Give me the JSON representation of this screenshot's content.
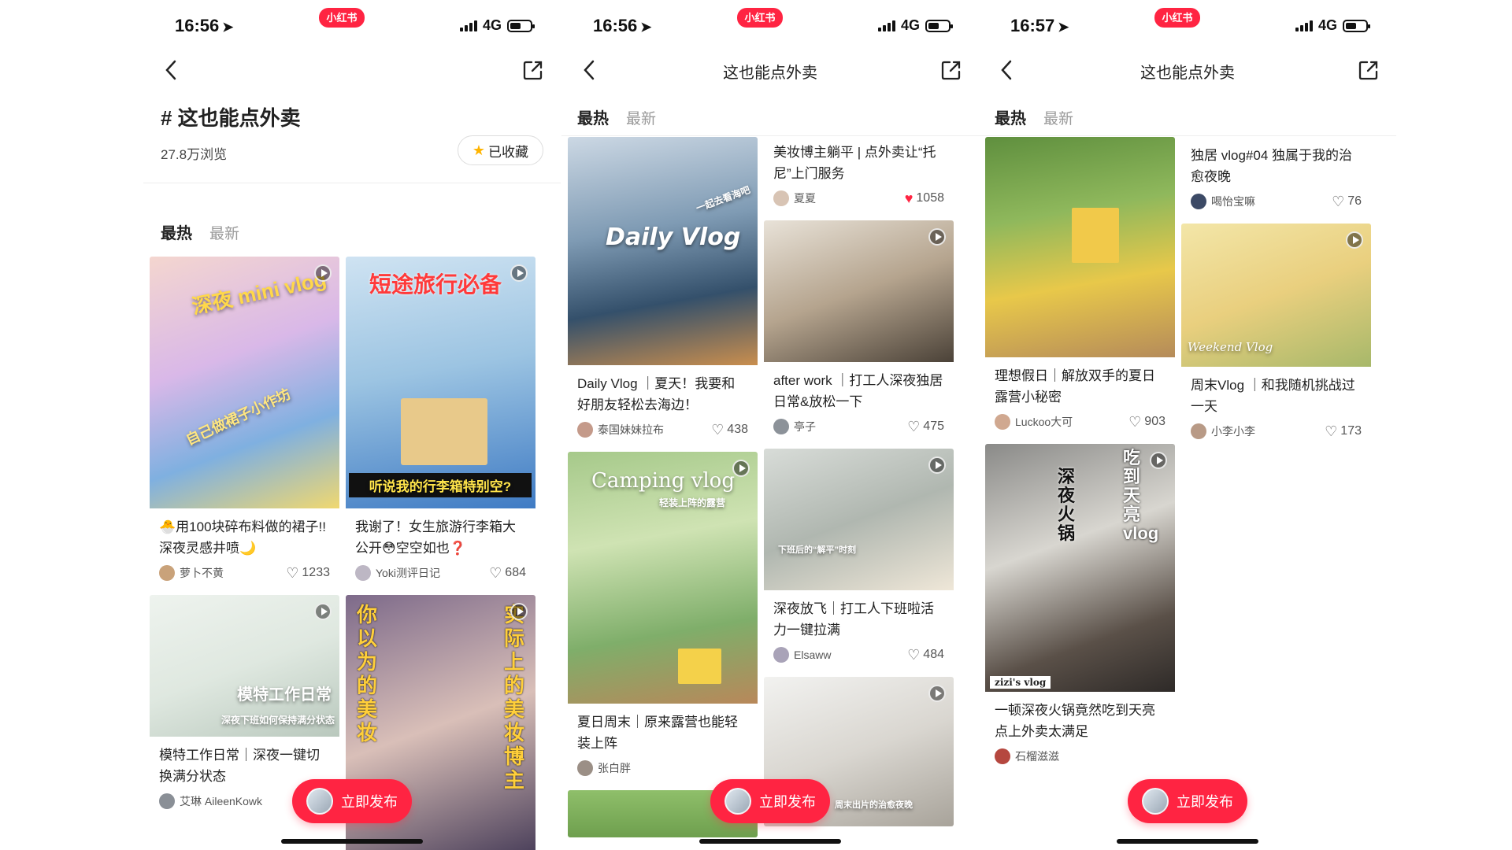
{
  "screens": [
    {
      "status": {
        "time": "16:56",
        "network": "4G",
        "app_badge": "小红书"
      },
      "nav": {
        "title": ""
      },
      "topic": {
        "title": "# 这也能点外卖",
        "views": "27.8万浏览",
        "fav_label": "已收藏"
      },
      "tabs": {
        "hot": "最热",
        "new": "最新"
      },
      "cards": [
        {
          "title": "🐣用100块碎布料做的裙子!!深夜灵感井喷🌙",
          "author": "萝卜不黄",
          "likes": "1233",
          "overlay": "深夜 mini vlog",
          "overlay2": "自己做裙子小作坊"
        },
        {
          "title": "我谢了！女生旅游行李箱大公开😳空空如也❓",
          "author": "Yoki测评日记",
          "likes": "684",
          "overlay": "短途旅行必备",
          "overlay2": "听说我的行李箱特别空?"
        },
        {
          "title": "模特工作日常｜深夜一键切换满分状态",
          "author": "艾琳 AileenKowk",
          "likes": "",
          "overlay": "模特工作日常",
          "overlay2": "深夜下班如何保持满分状态"
        },
        {
          "title": "",
          "author": "",
          "likes": "",
          "overlay": "你以为的美妆",
          "overlay2": "实际上的美妆博主"
        }
      ],
      "publish_label": "立即发布"
    },
    {
      "status": {
        "time": "16:56",
        "network": "4G",
        "app_badge": "小红书"
      },
      "nav": {
        "title": "这也能点外卖"
      },
      "tabs": {
        "hot": "最热",
        "new": "最新"
      },
      "cards": [
        {
          "title": "美妆博主躺平 | 点外卖让“托尼”上门服务",
          "author": "夏夏",
          "likes": "1058"
        },
        {
          "title": "Daily Vlog ｜夏天！我要和好朋友轻松去海边！",
          "author": "泰国妹妹拉布",
          "likes": "438",
          "overlay": "Daily Vlog",
          "overlay2": "一起去看海吧"
        },
        {
          "title": "after work ｜打工人深夜独居日常&放松一下",
          "author": "亭子",
          "likes": "475"
        },
        {
          "title": "夏日周末｜原来露营也能轻装上阵",
          "author": "张白胖",
          "likes": "",
          "overlay": "Camping vlog",
          "overlay2": "轻装上阵的露营"
        },
        {
          "title": "深夜放飞｜打工人下班啦活力一键拉满",
          "author": "Elsaww",
          "likes": "484",
          "overlay": "下班后的“解平”时刻"
        },
        {
          "title": "",
          "author": "",
          "likes": "",
          "overlay": "周末出片的治愈夜晚"
        }
      ],
      "publish_label": "立即发布"
    },
    {
      "status": {
        "time": "16:57",
        "network": "4G",
        "app_badge": "小红书"
      },
      "nav": {
        "title": "这也能点外卖"
      },
      "tabs": {
        "hot": "最热",
        "new": "最新"
      },
      "cards": [
        {
          "title": "理想假日｜解放双手的夏日露营小秘密",
          "author": "Luckoo大可",
          "likes": "903"
        },
        {
          "title": "独居 vlog#04 独属于我的治愈夜晚",
          "author": "喝怡宝嘛",
          "likes": "76"
        },
        {
          "title": "周末Vlog ｜和我随机挑战过一天",
          "author": "小李小李",
          "likes": "173",
          "overlay": "Weekend Vlog"
        },
        {
          "title": "一顿深夜火锅竟然吃到天亮 点上外卖太满足",
          "author": "石榴滋滋",
          "likes": "",
          "overlay": "吃到天亮vlog",
          "overlay2": "深夜火锅",
          "overlay3": "zizi's vlog"
        }
      ],
      "publish_label": "立即发布"
    }
  ],
  "colors": {
    "brand_red": "#ff2442",
    "like_red": "#ff2442",
    "text": "#222222",
    "muted": "#999999"
  }
}
